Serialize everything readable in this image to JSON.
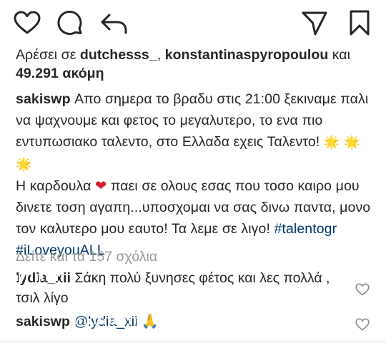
{
  "icons": {
    "like": "heart-outline-icon",
    "comment": "speech-bubble-icon",
    "reply": "reply-arrow-icon",
    "share": "paper-plane-icon",
    "save": "bookmark-icon"
  },
  "likes": {
    "prefix": "Αρέσει σε ",
    "user1": "dutchesss_",
    "separator": ", ",
    "user2": "konstantinaspyropoulou",
    "conjunction": " και",
    "others": "49.291 ακόμη"
  },
  "caption": {
    "username": "sakiswp",
    "line1": " Απο σημερα το βραδυ στις 21:00 ξεκιναμε παλι να ψαχνουμε και φετος το μεγαλυτερο, το ενα πιο εντυπωσιακο ταλεντο, στο Ελλαδα εχεις Ταλεντο! ",
    "sparkles": "🌟 🌟 🌟",
    "line2a": "Η καρδουλα ",
    "heart": "❤",
    "line2b": " παει σε ολους εσας που τοσο καιρο μου δινετε τοση αγαπη...υποσχομαι να σας δινω παντα, μονο τον καλυτερο μου εαυτο! Τα λεμε σε λιγο! ",
    "hashtag1": "#talentogr",
    "hashtag2": "#iLoveyouALL"
  },
  "view_all_comments": "Δείτε και τα 157 σχόλια",
  "comments": [
    {
      "username": "lydia_xii",
      "text": " Σάκη πολύ ξυνησες φέτος και λες πολλά , τσιλ λίγο"
    },
    {
      "username": "sakiswp",
      "mention": "@lydia_xii",
      "emoji": "🙏"
    }
  ]
}
